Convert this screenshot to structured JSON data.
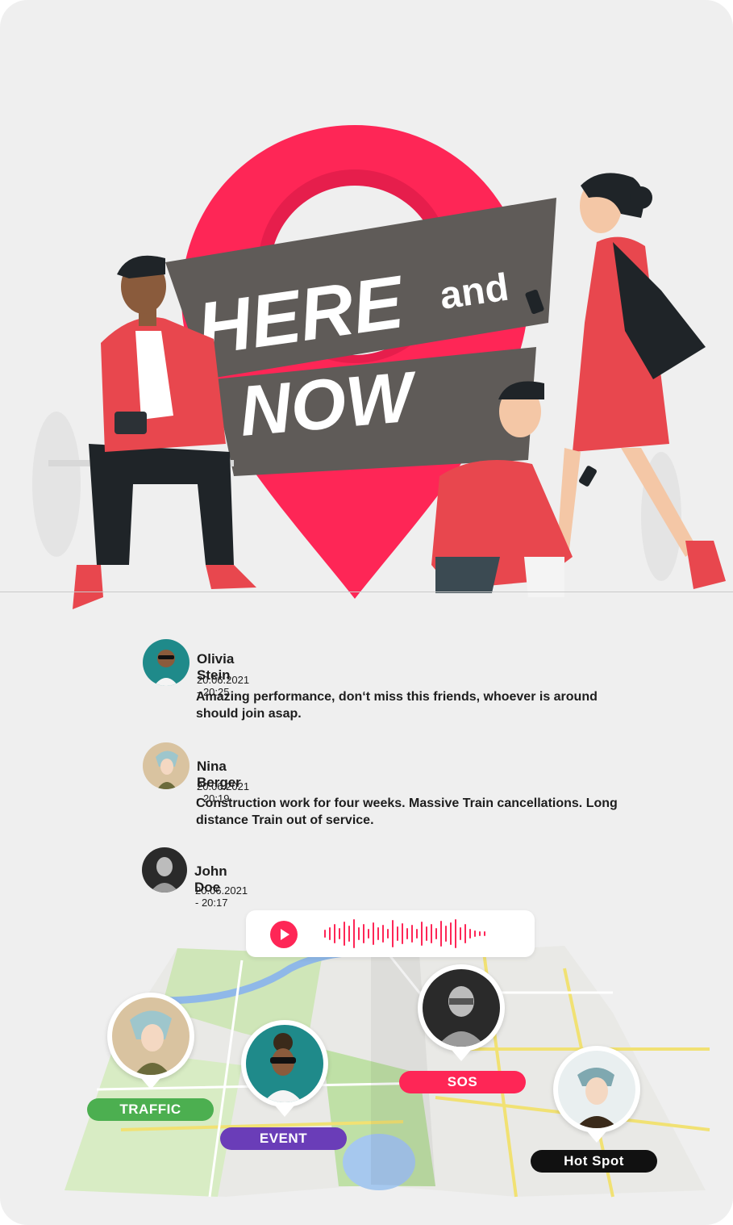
{
  "hero": {
    "title_line1": "HERE",
    "title_and": "and",
    "title_line2": "NOW"
  },
  "posts": [
    {
      "name": "Olivia Stein",
      "date": "20.06.2021 - 20:25",
      "text": "Amazing performance, don‘t miss this friends, whoever is around should join asap."
    },
    {
      "name": "Nina Berger",
      "date": "20.06.2021 - 20:19",
      "text": "Construction work for four weeks. Massive Train cancellations. Long distance Train out of service."
    },
    {
      "name": "John Doe",
      "date": "20.06.2021 - 20:17",
      "text": ""
    }
  ],
  "audio": {
    "icon": "play-icon"
  },
  "map_tags": [
    {
      "label": "TRAFFIC",
      "color": "#4caf50"
    },
    {
      "label": "EVENT",
      "color": "#6a3db8"
    },
    {
      "label": "SOS",
      "color": "#fe2656"
    },
    {
      "label": "Hot Spot",
      "color": "#111111"
    }
  ],
  "colors": {
    "accent": "#fe2656",
    "banner": "#5f5b58",
    "background": "#efefef"
  }
}
